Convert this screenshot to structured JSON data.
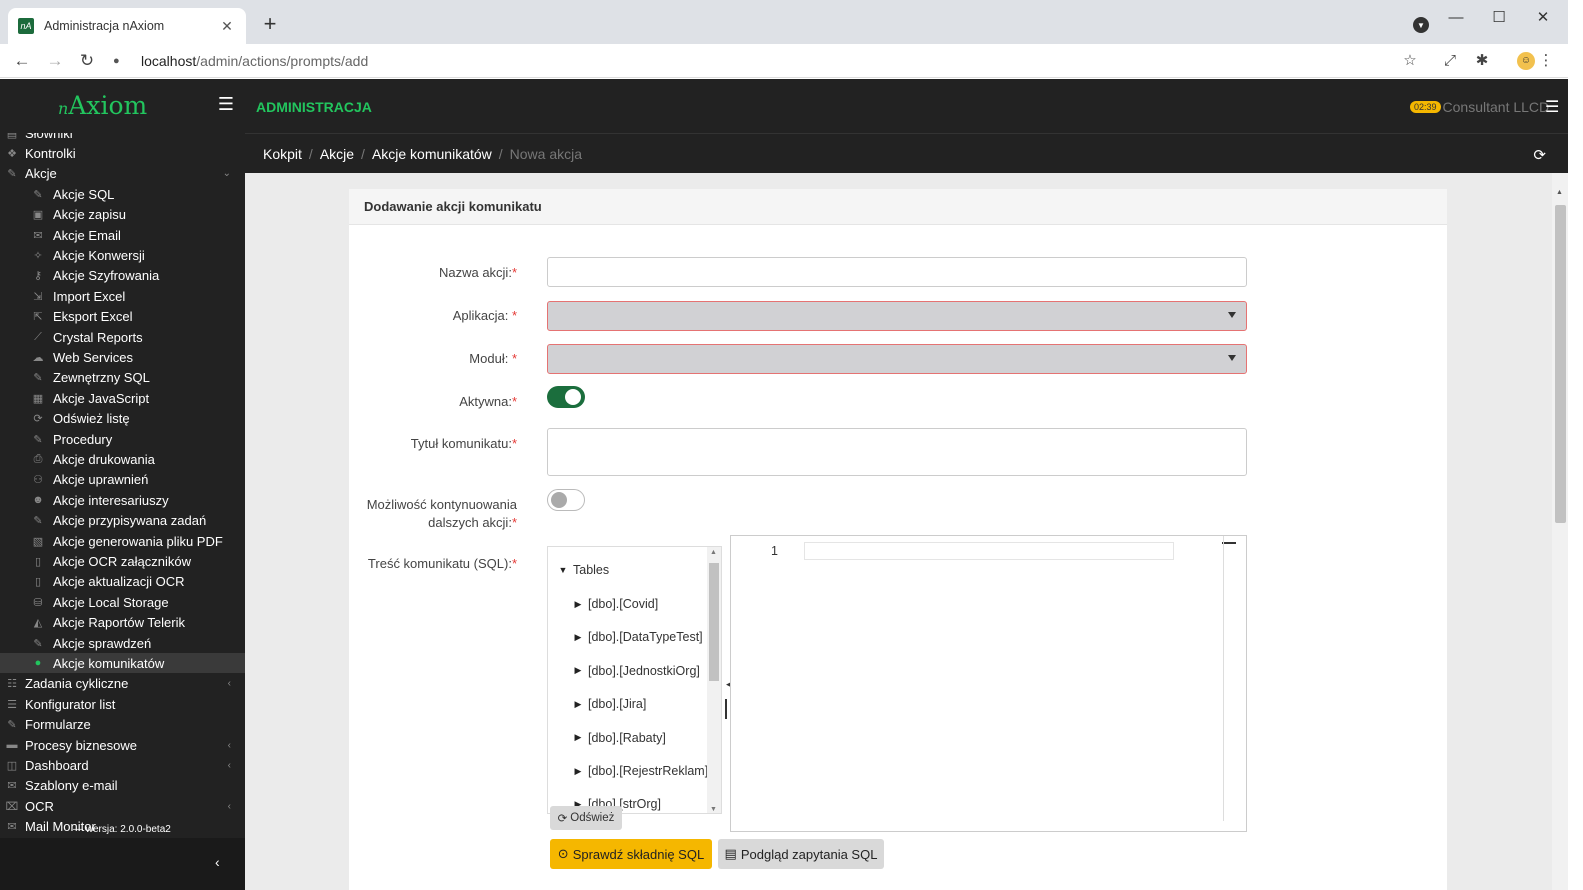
{
  "browser": {
    "tab_title": "Administracja nAxiom",
    "tab_favicon": "nA",
    "url_host": "localhost",
    "url_path": "/admin/actions/prompts/add"
  },
  "header": {
    "logo_prefix": "n",
    "logo": "Axiom",
    "admin_label": "ADMINISTRACJA",
    "badge": "02:39",
    "company": "Consultant LLCD"
  },
  "sidebar": {
    "items": [
      {
        "label": "Słowniki",
        "icon": "book-icon",
        "sub": false
      },
      {
        "label": "Kontrolki",
        "icon": "cubes-icon",
        "sub": false
      },
      {
        "label": "Akcje",
        "icon": "pencil-icon",
        "sub": false,
        "arrow": "⌄"
      },
      {
        "label": "Akcje SQL",
        "icon": "pencil-icon",
        "sub": true
      },
      {
        "label": "Akcje zapisu",
        "icon": "save-icon",
        "sub": true
      },
      {
        "label": "Akcje Email",
        "icon": "email-icon",
        "sub": true
      },
      {
        "label": "Akcje Konwersji",
        "icon": "wand-icon",
        "sub": true
      },
      {
        "label": "Akcje Szyfrowania",
        "icon": "key-icon",
        "sub": true
      },
      {
        "label": "Import Excel",
        "icon": "file-import-icon",
        "sub": true
      },
      {
        "label": "Eksport Excel",
        "icon": "file-export-icon",
        "sub": true
      },
      {
        "label": "Crystal Reports",
        "icon": "chart-line-icon",
        "sub": true
      },
      {
        "label": "Web Services",
        "icon": "cloud-icon",
        "sub": true
      },
      {
        "label": "Zewnętrzny SQL",
        "icon": "pencil-icon",
        "sub": true
      },
      {
        "label": "Akcje JavaScript",
        "icon": "js-icon",
        "sub": true
      },
      {
        "label": "Odśwież listę",
        "icon": "sync-icon",
        "sub": true
      },
      {
        "label": "Procedury",
        "icon": "pencil-icon",
        "sub": true
      },
      {
        "label": "Akcje drukowania",
        "icon": "print-icon",
        "sub": true
      },
      {
        "label": "Akcje uprawnień",
        "icon": "user-lock-icon",
        "sub": true
      },
      {
        "label": "Akcje interesariuszy",
        "icon": "user-icon",
        "sub": true
      },
      {
        "label": "Akcje przypisywana zadań",
        "icon": "pencil-icon",
        "sub": true
      },
      {
        "label": "Akcje generowania pliku PDF",
        "icon": "file-pdf-icon",
        "sub": true
      },
      {
        "label": "Akcje OCR załączników",
        "icon": "file-icon",
        "sub": true
      },
      {
        "label": "Akcje aktualizacji OCR",
        "icon": "file-alt-icon",
        "sub": true
      },
      {
        "label": "Akcje Local Storage",
        "icon": "database-icon",
        "sub": true
      },
      {
        "label": "Akcje Raportów Telerik",
        "icon": "chart-area-icon",
        "sub": true
      },
      {
        "label": "Akcje sprawdzeń",
        "icon": "pencil-icon",
        "sub": true
      },
      {
        "label": "Akcje komunikatów",
        "icon": "comment-icon",
        "sub": true,
        "active": true
      },
      {
        "label": "Zadania cykliczne",
        "icon": "tasks-icon",
        "sub": false,
        "arrow": "‹"
      },
      {
        "label": "Konfigurator list",
        "icon": "list-icon",
        "sub": false
      },
      {
        "label": "Formularze",
        "icon": "pencil-icon",
        "sub": false
      },
      {
        "label": "Procesy biznesowe",
        "icon": "briefcase-icon",
        "sub": false,
        "arrow": "‹"
      },
      {
        "label": "Dashboard",
        "icon": "dashboard-icon",
        "sub": false,
        "arrow": "‹"
      },
      {
        "label": "Szablony e-mail",
        "icon": "envelope-icon",
        "sub": false
      },
      {
        "label": "OCR",
        "icon": "ocr-icon",
        "sub": false,
        "arrow": "‹"
      },
      {
        "label": "Mail Monitor",
        "icon": "mail-icon",
        "sub": false
      }
    ],
    "version": "— wersja: 2.0.0-beta2"
  },
  "breadcrumb": {
    "items": [
      "Kokpit",
      "Akcje",
      "Akcje komunikatów"
    ],
    "current": "Nowa akcja"
  },
  "form": {
    "title": "Dodawanie akcji komunikatu",
    "name_label": "Nazwa akcji:",
    "name_value": "",
    "app_label": "Aplikacja: ",
    "app_value": "",
    "module_label": "Moduł: ",
    "module_value": "",
    "active_label": "Aktywna:",
    "active_value": true,
    "msg_title_label": "Tytuł komunikatu:",
    "msg_title_value": "",
    "continue_label_1": "Możliwość kontynuowania",
    "continue_label_2": "dalszych akcji:",
    "continue_value": false,
    "sql_label": "Treść komunikatu (SQL):",
    "required_mark": "*"
  },
  "tree": {
    "root": "Tables",
    "tables": [
      "[dbo].[Covid]",
      "[dbo].[DataTypeTest]",
      "[dbo].[JednostkiOrg]",
      "[dbo].[Jira]",
      "[dbo].[Rabaty]",
      "[dbo].[RejestrReklam]",
      "[dbo].[strOrg]"
    ],
    "refresh_label": "Odśwież"
  },
  "editor": {
    "line_number": "1",
    "content": ""
  },
  "buttons": {
    "check_sql": "Sprawdź składnię SQL",
    "preview_sql": "Podgląd zapytania SQL"
  },
  "colors": {
    "accent_green": "#22c55e",
    "toggle_on": "#1b6e3d",
    "warning_yellow": "#f5b700",
    "error_red": "#e53935"
  }
}
